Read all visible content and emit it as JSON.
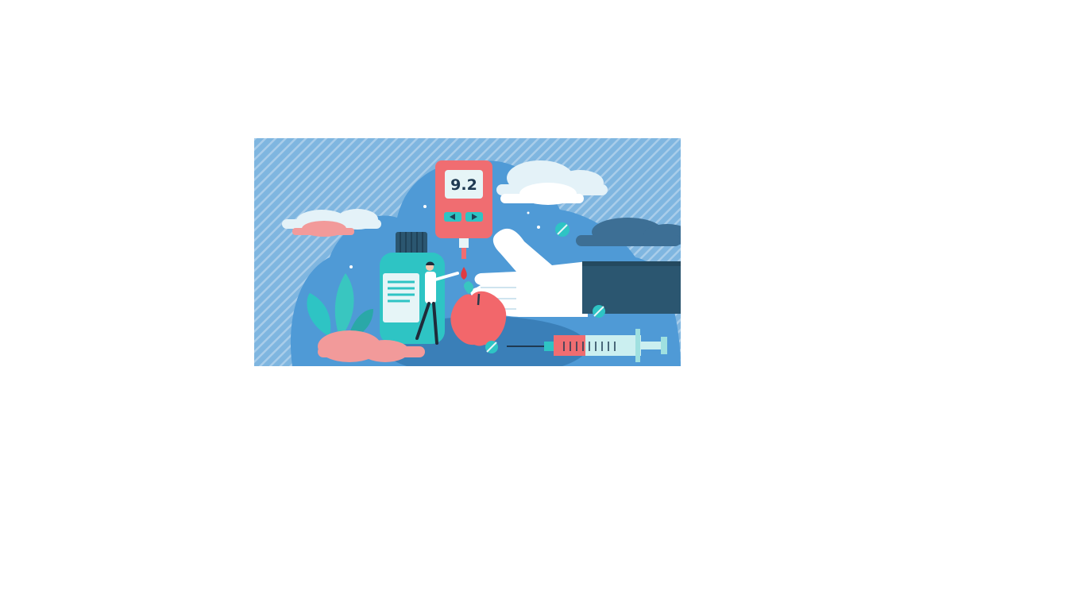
{
  "illustration": {
    "meter_reading": "9.2",
    "colors": {
      "background": "#7fb6e0",
      "stripe": "#a9cdea",
      "blob": "#4f9ad6",
      "cloud_white": "#e4f2f8",
      "cloud_pink": "#f29a9a",
      "cloud_dark": "#3d6f95",
      "meter_red": "#f06d71",
      "meter_screen": "#e6f5f7",
      "teal": "#2ec4c4",
      "sleeve": "#2b5670",
      "hand": "#ffffff",
      "apple": "#f2676b",
      "leaf": "#39c6c0"
    }
  }
}
